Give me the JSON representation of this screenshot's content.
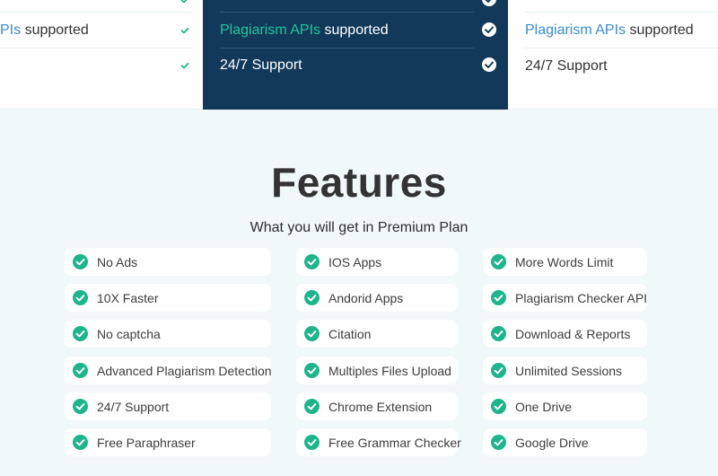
{
  "colors": {
    "accent_green": "#1fb58c",
    "plan_highlight_bg": "#12395a",
    "link_blue": "#3b8bd0",
    "link_green": "#1fc59d",
    "section_bg": "#f1f8fa"
  },
  "pricing": {
    "left": {
      "api_highlight": "PIs",
      "api_suffix": " supported"
    },
    "middle": {
      "api_highlight": "Plagiarism APIs",
      "api_suffix": " supported",
      "support": "24/7 Support"
    },
    "right": {
      "api_highlight": "Plagiarism APIs",
      "api_suffix": " supported",
      "support": "24/7 Support"
    },
    "check_icon": "check-circle-icon"
  },
  "features": {
    "title": "Features",
    "subtitle": "What you will get in Premium Plan",
    "check_icon": "check-circle-icon",
    "columns": [
      [
        "No Ads",
        "10X Faster",
        "No captcha",
        "Advanced Plagiarism Detection",
        "24/7 Support",
        "Free Paraphraser"
      ],
      [
        "IOS Apps",
        "Andorid Apps",
        "Citation",
        "Multiples Files Upload",
        "Chrome Extension",
        "Free Grammar Checker"
      ],
      [
        "More Words Limit",
        "Plagiarism Checker API",
        "Download & Reports",
        "Unlimited Sessions",
        "One Drive",
        "Google Drive"
      ]
    ]
  }
}
